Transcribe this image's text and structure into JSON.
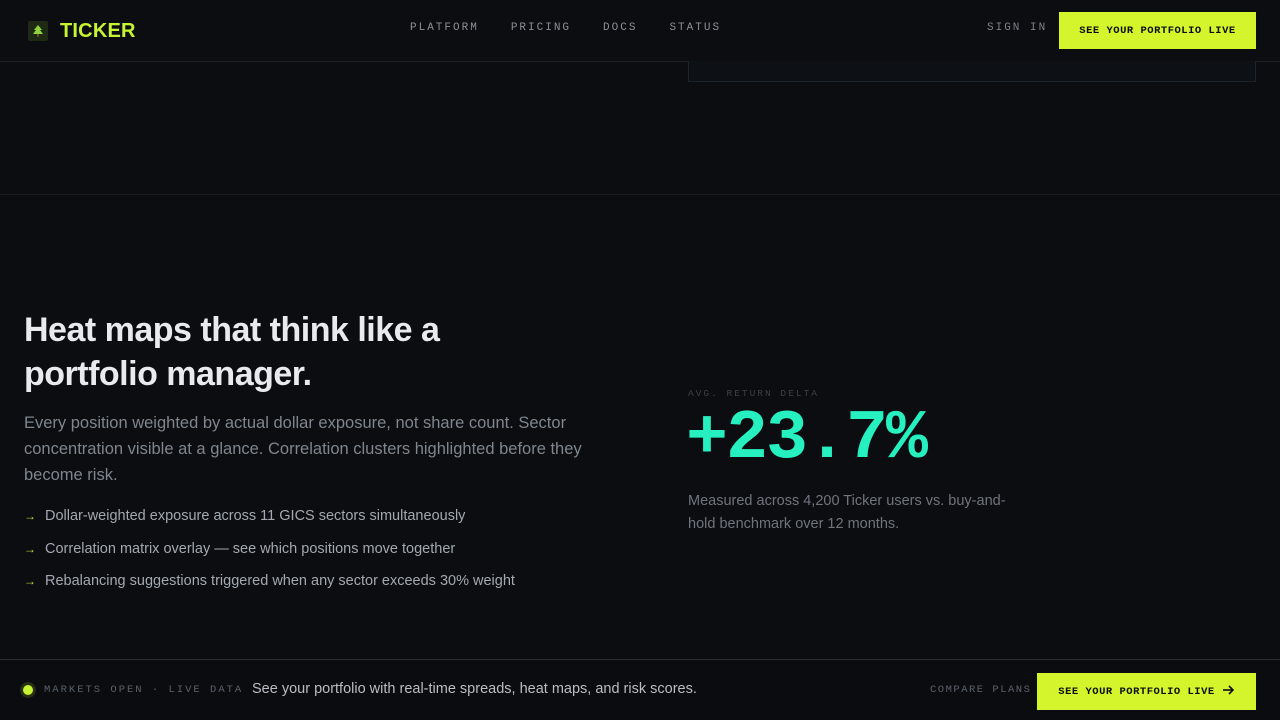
{
  "brand": {
    "name": "TICKER",
    "logo_icon": "tree-icon",
    "accent_color": "#d4f52c"
  },
  "nav": {
    "links": [
      "PLATFORM",
      "PRICING",
      "DOCS",
      "STATUS"
    ],
    "sign_in": "SIGN IN",
    "cta": "SEE YOUR PORTFOLIO LIVE"
  },
  "hero": {
    "headline": "Heat maps that think like a portfolio manager.",
    "subtext": "Every position weighted by actual dollar exposure, not share count. Sector concentration visible at a glance. Correlation clusters highlighted before they become risk.",
    "bullets": [
      "Dollar-weighted exposure across 11 GICS sectors simultaneously",
      "Correlation matrix overlay — see which positions move together",
      "Rebalancing suggestions triggered when any sector exceeds 30% weight"
    ],
    "bullet_icon": "arrow-right-icon"
  },
  "stat": {
    "label": "AVG. RETURN DELTA",
    "value": "+23.7%",
    "value_color": "#27f0c0",
    "note": "Measured across 4,200 Ticker users vs. buy-and-hold benchmark over 12 months."
  },
  "bottom_bar": {
    "status": "MARKETS OPEN · LIVE DATA",
    "message": "See your portfolio with real-time spreads, heat maps, and risk scores.",
    "compare": "COMPARE PLANS",
    "cta": "SEE YOUR PORTFOLIO LIVE",
    "cta_icon": "arrow-right-icon"
  }
}
